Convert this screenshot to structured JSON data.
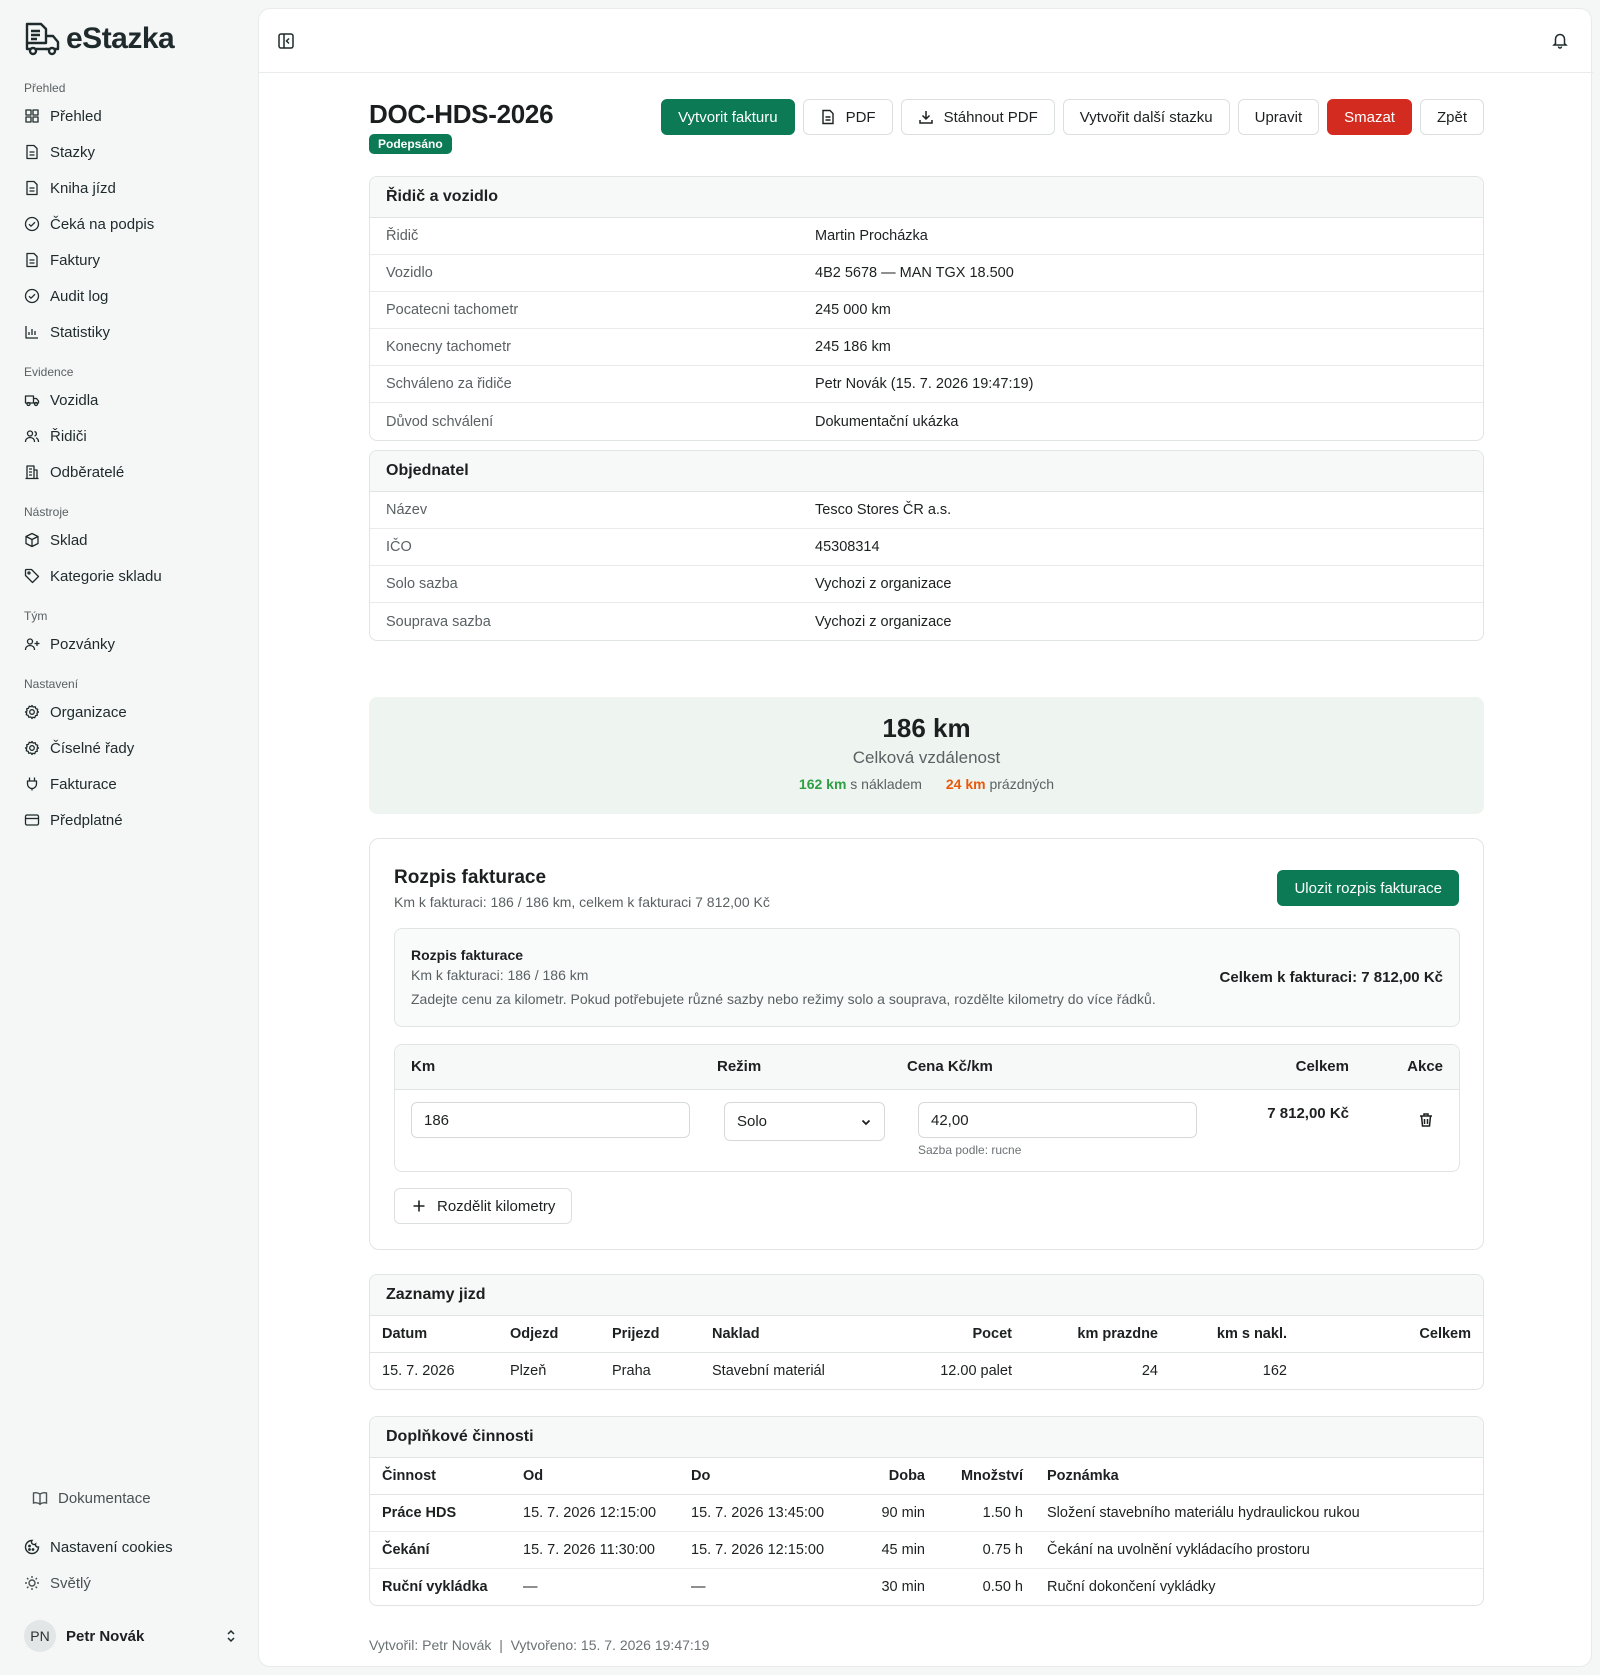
{
  "app": {
    "name": "eStazka"
  },
  "sidebar": {
    "sections": [
      {
        "label": "Přehled",
        "items": [
          {
            "label": "Přehled",
            "icon": "grid-icon"
          },
          {
            "label": "Stazky",
            "icon": "file-icon"
          },
          {
            "label": "Kniha jízd",
            "icon": "file-icon"
          },
          {
            "label": "Čeká na podpis",
            "icon": "check-circle-icon"
          },
          {
            "label": "Faktury",
            "icon": "file-icon"
          },
          {
            "label": "Audit log",
            "icon": "check-circle-icon"
          },
          {
            "label": "Statistiky",
            "icon": "chart-icon"
          }
        ]
      },
      {
        "label": "Evidence",
        "items": [
          {
            "label": "Vozidla",
            "icon": "truck-icon"
          },
          {
            "label": "Řidiči",
            "icon": "users-icon"
          },
          {
            "label": "Odběratelé",
            "icon": "building-icon"
          }
        ]
      },
      {
        "label": "Nástroje",
        "items": [
          {
            "label": "Sklad",
            "icon": "box-icon"
          },
          {
            "label": "Kategorie skladu",
            "icon": "tag-icon"
          }
        ]
      },
      {
        "label": "Tým",
        "items": [
          {
            "label": "Pozvánky",
            "icon": "user-plus-icon"
          }
        ]
      },
      {
        "label": "Nastavení",
        "items": [
          {
            "label": "Organizace",
            "icon": "gear-icon"
          },
          {
            "label": "Číselné řady",
            "icon": "gear-icon"
          },
          {
            "label": "Fakturace",
            "icon": "plug-icon"
          },
          {
            "label": "Předplatné",
            "icon": "card-icon"
          }
        ]
      }
    ],
    "documentation": "Dokumentace",
    "cookies": "Nastavení cookies",
    "theme": "Světlý",
    "user": {
      "initials": "PN",
      "name": "Petr Novák"
    }
  },
  "page": {
    "title": "DOC-HDS-2026",
    "status": "Podepsáno",
    "actions": {
      "invoice": "Vytvorit fakturu",
      "pdf": "PDF",
      "download_pdf": "Stáhnout PDF",
      "create_next": "Vytvořit další stazku",
      "edit": "Upravit",
      "delete": "Smazat",
      "back": "Zpět"
    }
  },
  "driver_vehicle": {
    "title": "Řidič a vozidlo",
    "rows": [
      {
        "k": "Řidič",
        "v": "Martin Procházka"
      },
      {
        "k": "Vozidlo",
        "v": "4B2 5678 — MAN TGX 18.500"
      },
      {
        "k": "Pocatecni tachometr",
        "v": "245 000 km"
      },
      {
        "k": "Konecny tachometr",
        "v": "245 186 km"
      },
      {
        "k": "Schváleno za řidiče",
        "v": "Petr Novák (15. 7. 2026 19:47:19)"
      },
      {
        "k": "Důvod schválení",
        "v": "Dokumentační ukázka"
      }
    ]
  },
  "customer": {
    "title": "Objednatel",
    "rows": [
      {
        "k": "Název",
        "v": "Tesco Stores ČR a.s."
      },
      {
        "k": "IČO",
        "v": "45308314"
      },
      {
        "k": "Solo sazba",
        "v": "Vychozi z organizace"
      },
      {
        "k": "Souprava sazba",
        "v": "Vychozi z organizace"
      }
    ]
  },
  "distance": {
    "total": "186 km",
    "label": "Celková vzdálenost",
    "loaded_value": "162 km",
    "loaded_label": "s nákladem",
    "empty_value": "24 km",
    "empty_label": "prázdných"
  },
  "billing": {
    "title": "Rozpis fakturace",
    "subtitle": "Km k fakturaci: 186 / 186 km, celkem k fakturaci 7 812,00 Kč",
    "save": "Ulozit rozpis fakturace",
    "info_title": "Rozpis fakturace",
    "info_km": "Km k fakturaci: 186 / 186 km",
    "info_hint": "Zadejte cenu za kilometr. Pokud potřebujete různé sazby nebo režimy solo a souprava, rozdělte kilometry do více řádků.",
    "info_total": "Celkem k fakturaci: 7 812,00 Kč",
    "columns": {
      "km": "Km",
      "mode": "Režim",
      "price": "Cena Kč/km",
      "total": "Celkem",
      "actions": "Akce"
    },
    "line": {
      "km": "186",
      "mode": "Solo",
      "price": "42,00",
      "rate_source": "Sazba podle: rucne",
      "total": "7 812,00 Kč"
    },
    "split": "Rozdělit kilometry"
  },
  "trips": {
    "title": "Zaznamy jizd",
    "columns": [
      "Datum",
      "Odjezd",
      "Prijezd",
      "Naklad",
      "Pocet",
      "km prazdne",
      "km s nakl.",
      "Celkem"
    ],
    "rows": [
      [
        "15. 7. 2026",
        "Plzeň",
        "Praha",
        "Stavební materiál",
        "12.00 palet",
        "24",
        "162",
        ""
      ]
    ]
  },
  "activities": {
    "title": "Doplňkové činnosti",
    "columns": [
      "Činnost",
      "Od",
      "Do",
      "Doba",
      "Množství",
      "Poznámka"
    ],
    "rows": [
      [
        "Práce HDS",
        "15. 7. 2026 12:15:00",
        "15. 7. 2026 13:45:00",
        "90 min",
        "1.50 h",
        "Složení stavebního materiálu hydraulickou rukou"
      ],
      [
        "Čekání",
        "15. 7. 2026 11:30:00",
        "15. 7. 2026 12:15:00",
        "45 min",
        "0.75 h",
        "Čekání na uvolnění vykládacího prostoru"
      ],
      [
        "Ruční vykládka",
        "—",
        "—",
        "30 min",
        "0.50 h",
        "Ruční dokončení vykládky"
      ]
    ]
  },
  "footer": {
    "created_by": "Vytvořil: Petr Novák",
    "sep": "|",
    "created_at": "Vytvořeno: 15. 7. 2026 19:47:19"
  }
}
